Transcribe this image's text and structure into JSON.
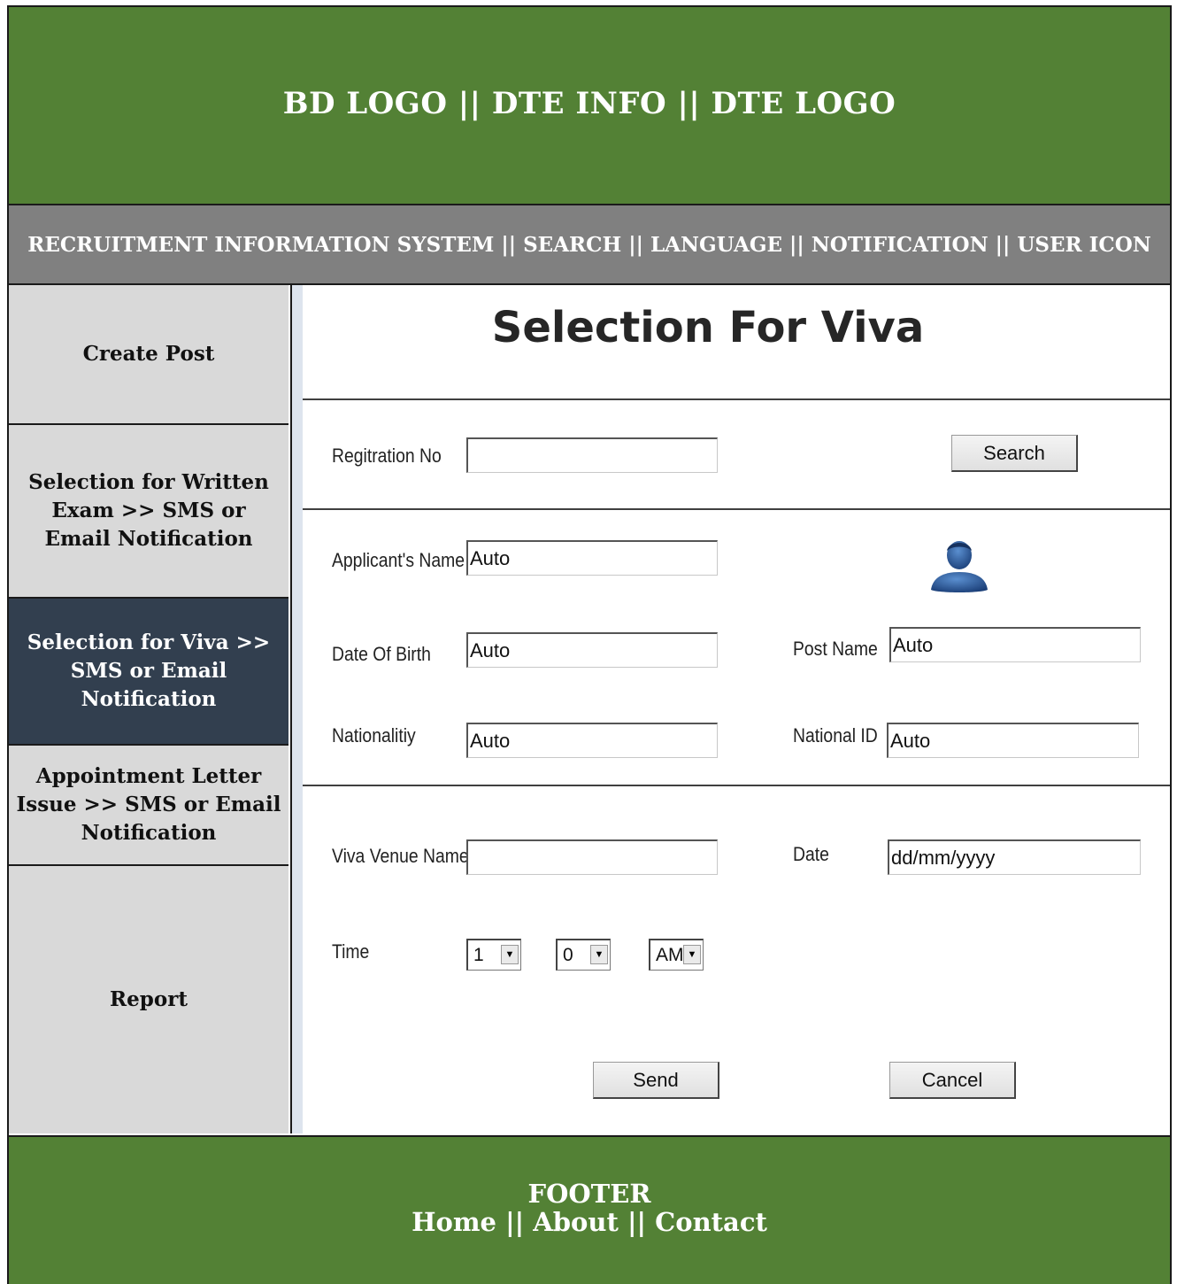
{
  "header": {
    "text": "BD LOGO || DTE INFO || DTE LOGO"
  },
  "navbar": {
    "text": "RECRUITMENT INFORMATION SYSTEM || SEARCH || LANGUAGE || NOTIFICATION || USER ICON"
  },
  "sidebar": {
    "items": [
      {
        "label": "Create Post"
      },
      {
        "label": "Selection for Written Exam >> SMS or Email Notification"
      },
      {
        "label": "Selection for Viva >> SMS or Email Notification"
      },
      {
        "label": "Appointment Letter Issue >> SMS or Email Notification"
      },
      {
        "label": "Report"
      }
    ],
    "active_index": 2
  },
  "main": {
    "title": "Selection For Viva",
    "registration": {
      "label": "Regitration No",
      "value": "",
      "search_label": "Search"
    },
    "applicant": {
      "name_label": "Applicant's Name",
      "name_value": "Auto",
      "dob_label": "Date Of Birth",
      "dob_value": "Auto",
      "post_label": "Post Name",
      "post_value": "Auto",
      "nationality_label": "Nationalitiy",
      "nationality_value": "Auto",
      "nid_label": "National ID",
      "nid_value": "Auto",
      "avatar_icon": "user-avatar-icon"
    },
    "viva": {
      "venue_label": "Viva Venue Name",
      "venue_value": "",
      "date_label": "Date",
      "date_value": "dd/mm/yyyy",
      "time_label": "Time",
      "hour": "1",
      "minute": "0",
      "ampm": "AM"
    },
    "send_label": "Send",
    "cancel_label": "Cancel"
  },
  "footer": {
    "title": "FOOTER",
    "links": "Home || About || Contact"
  },
  "colors": {
    "header_bg": "#538135",
    "navbar_bg": "#808080",
    "sidebar_bg": "#d9d9d9",
    "sidebar_active_bg": "#323f4f"
  }
}
